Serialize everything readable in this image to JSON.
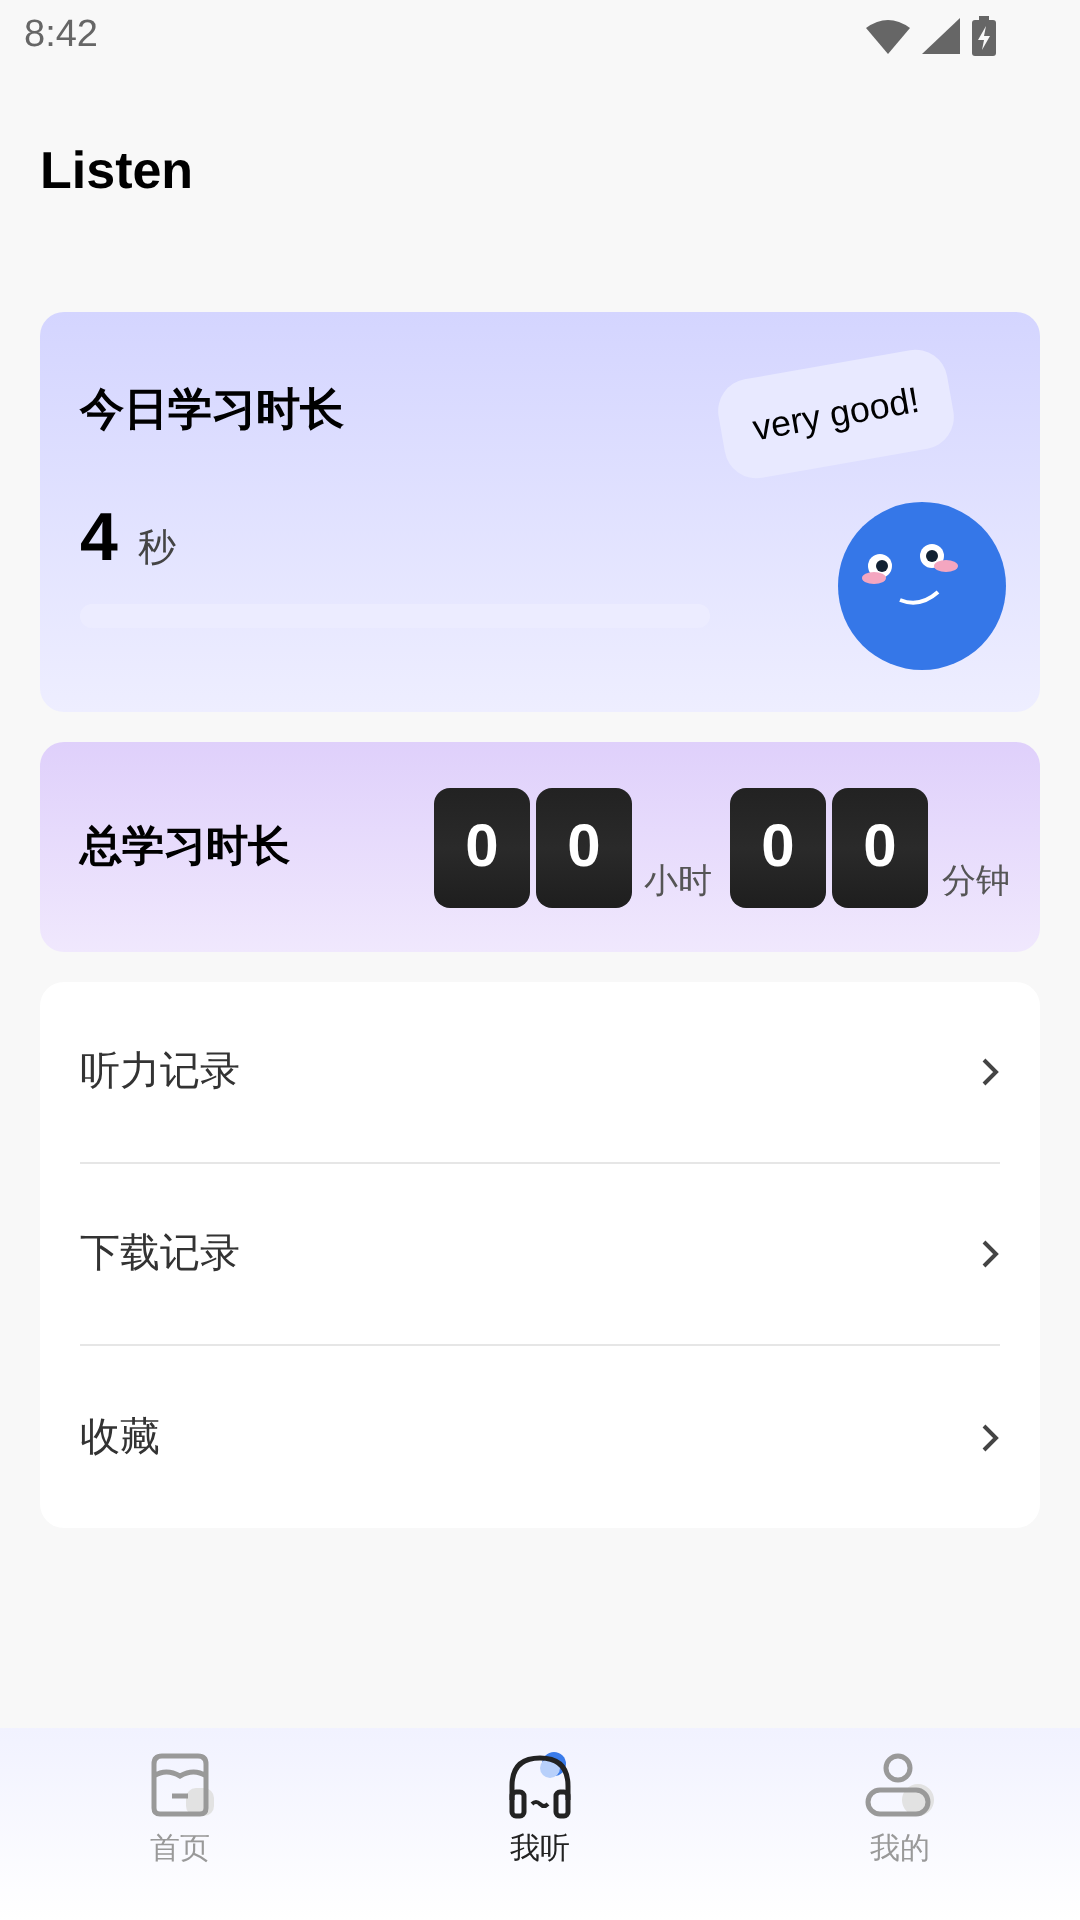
{
  "status_bar": {
    "time": "8:42"
  },
  "title": "Listen",
  "today": {
    "title": "今日学习时长",
    "value": "4",
    "unit": "秒",
    "level": 0,
    "bubble": "very good!"
  },
  "total": {
    "title": "总学习时长",
    "hours": [
      "0",
      "0"
    ],
    "hours_unit": "小时",
    "minutes": [
      "0",
      "0"
    ],
    "minutes_unit": "分钟"
  },
  "menu": [
    {
      "label": "听力记录"
    },
    {
      "label": "下载记录"
    },
    {
      "label": "收藏"
    }
  ],
  "nav": [
    {
      "label": "首页",
      "kind": "home",
      "selected": false
    },
    {
      "label": "我听",
      "kind": "listen",
      "selected": true
    },
    {
      "label": "我的",
      "kind": "profile",
      "selected": false
    }
  ]
}
